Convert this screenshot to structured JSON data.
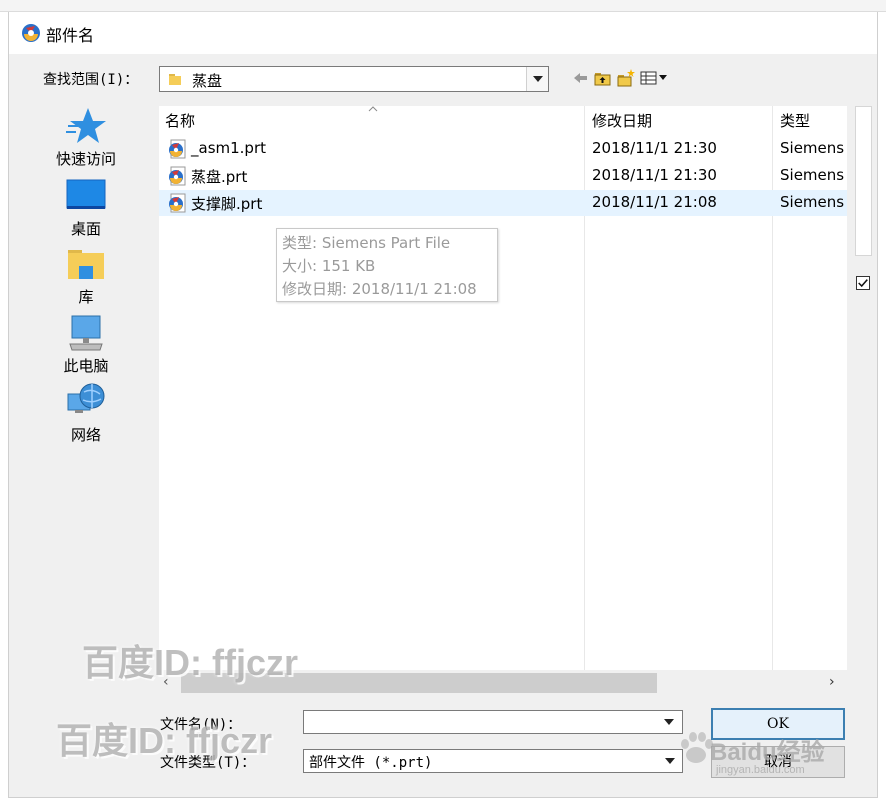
{
  "window": {
    "title": "部件名"
  },
  "lookin": {
    "label": "查找范围(I)：",
    "value": "蒸盘"
  },
  "places": [
    {
      "label": "快速访问",
      "icon": "quick-access-star-icon"
    },
    {
      "label": "桌面",
      "icon": "desktop-icon"
    },
    {
      "label": "库",
      "icon": "library-icon"
    },
    {
      "label": "此电脑",
      "icon": "this-pc-icon"
    },
    {
      "label": "网络",
      "icon": "network-icon"
    }
  ],
  "columns": {
    "name": "名称",
    "date": "修改日期",
    "type": "类型"
  },
  "files": [
    {
      "name": "_asm1.prt",
      "date": "2018/11/1 21:30",
      "type": "Siemens"
    },
    {
      "name": "蒸盘.prt",
      "date": "2018/11/1 21:30",
      "type": "Siemens"
    },
    {
      "name": "支撑脚.prt",
      "date": "2018/11/1 21:08",
      "type": "Siemens"
    }
  ],
  "tooltip": {
    "line1": "类型: Siemens Part File",
    "line2": "大小: 151 KB",
    "line3": "修改日期: 2018/11/1 21:08"
  },
  "bottom": {
    "filename_label": "文件名(N)：",
    "filename_value": "",
    "filetype_label": "文件类型(T)：",
    "filetype_value": "部件文件 (*.prt)",
    "ok_label": "OK",
    "cancel_label": "取消"
  },
  "watermarks": {
    "line1": "百度ID: ffjczr",
    "line2": "百度ID: ffjczr",
    "baidu_logo": "Baidu经验",
    "baidu_url": "jingyan.baidu.com"
  },
  "colors": {
    "selection": "#e5f3ff",
    "dialog_bg": "#f0f0f0",
    "default_button_border": "#3c7fb1"
  }
}
